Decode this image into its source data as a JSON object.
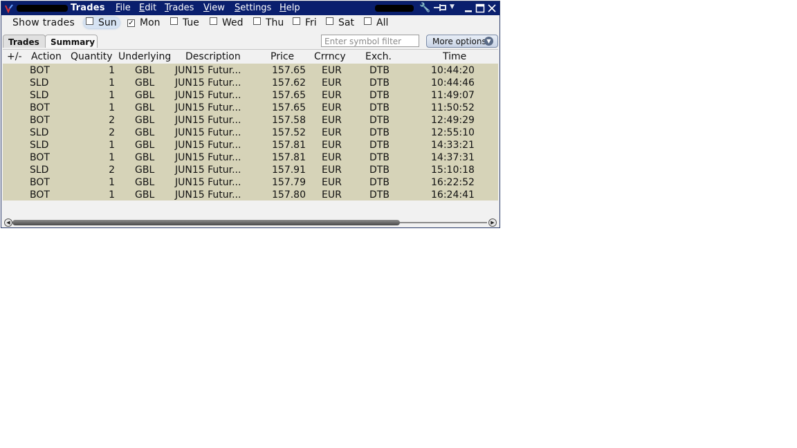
{
  "window": {
    "title": "Trades",
    "menu": [
      {
        "underline": "F",
        "rest": "ile"
      },
      {
        "underline": "E",
        "rest": "dit"
      },
      {
        "underline": "T",
        "rest": "rades"
      },
      {
        "underline": "V",
        "rest": "iew"
      },
      {
        "underline": "S",
        "rest": "ettings"
      },
      {
        "underline": "H",
        "rest": "elp"
      }
    ],
    "icons": [
      "wrench-icon",
      "pin-icon",
      "dropdown-icon",
      "minimize-icon",
      "maximize-icon",
      "close-icon"
    ]
  },
  "show_trades": {
    "label": "Show trades",
    "days": [
      {
        "label": "Sun",
        "checked": false,
        "highlighted": true
      },
      {
        "label": "Mon",
        "checked": true,
        "highlighted": false
      },
      {
        "label": "Tue",
        "checked": false,
        "highlighted": false
      },
      {
        "label": "Wed",
        "checked": false,
        "highlighted": false
      },
      {
        "label": "Thu",
        "checked": false,
        "highlighted": false
      },
      {
        "label": "Fri",
        "checked": false,
        "highlighted": false
      },
      {
        "label": "Sat",
        "checked": false,
        "highlighted": false
      },
      {
        "label": "All",
        "checked": false,
        "highlighted": false
      }
    ]
  },
  "tabs": [
    {
      "label": "Trades",
      "active": false
    },
    {
      "label": "Summary",
      "active": true
    }
  ],
  "filter": {
    "placeholder": "Enter symbol filter",
    "value": ""
  },
  "more_options": {
    "label": "More options"
  },
  "table": {
    "columns": [
      "+/-",
      "Action",
      "Quantity",
      "Underlying",
      "Description",
      "Price",
      "Crrncy",
      "Exch.",
      "Time"
    ],
    "rows": [
      [
        "",
        "BOT",
        "1",
        "GBL",
        "JUN15 Futur...",
        "157.65",
        "EUR",
        "DTB",
        "10:44:20"
      ],
      [
        "",
        "SLD",
        "1",
        "GBL",
        "JUN15 Futur...",
        "157.62",
        "EUR",
        "DTB",
        "10:44:46"
      ],
      [
        "",
        "SLD",
        "1",
        "GBL",
        "JUN15 Futur...",
        "157.65",
        "EUR",
        "DTB",
        "11:49:07"
      ],
      [
        "",
        "BOT",
        "1",
        "GBL",
        "JUN15 Futur...",
        "157.65",
        "EUR",
        "DTB",
        "11:50:52"
      ],
      [
        "",
        "BOT",
        "2",
        "GBL",
        "JUN15 Futur...",
        "157.58",
        "EUR",
        "DTB",
        "12:49:29"
      ],
      [
        "",
        "SLD",
        "2",
        "GBL",
        "JUN15 Futur...",
        "157.52",
        "EUR",
        "DTB",
        "12:55:10"
      ],
      [
        "",
        "SLD",
        "1",
        "GBL",
        "JUN15 Futur...",
        "157.81",
        "EUR",
        "DTB",
        "14:33:21"
      ],
      [
        "",
        "BOT",
        "1",
        "GBL",
        "JUN15 Futur...",
        "157.81",
        "EUR",
        "DTB",
        "14:37:31"
      ],
      [
        "",
        "SLD",
        "2",
        "GBL",
        "JUN15 Futur...",
        "157.91",
        "EUR",
        "DTB",
        "15:10:18"
      ],
      [
        "",
        "BOT",
        "1",
        "GBL",
        "JUN15 Futur...",
        "157.79",
        "EUR",
        "DTB",
        "16:22:52"
      ],
      [
        "",
        "BOT",
        "1",
        "GBL",
        "JUN15 Futur...",
        "157.80",
        "EUR",
        "DTB",
        "16:24:41"
      ]
    ]
  },
  "colors": {
    "titlebar": "#0a1f6e",
    "grid_bg": "#d6d3b8",
    "window_bg": "#f1f1f1"
  }
}
